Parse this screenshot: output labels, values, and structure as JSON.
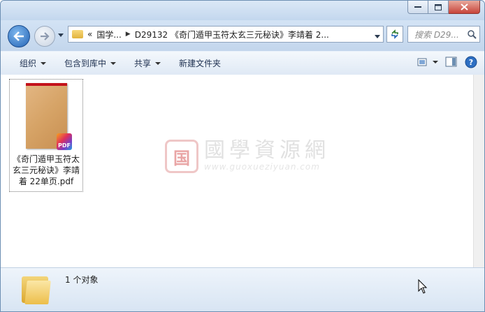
{
  "address": {
    "overflow": "«",
    "crumbs": [
      "国学...",
      "D29132 《奇门遁甲玉符太玄三元秘诀》李靖着 2..."
    ]
  },
  "search": {
    "placeholder": "搜索 D29..."
  },
  "toolbar": {
    "organize": "组织",
    "include_in_library": "包含到库中",
    "share": "共享",
    "new_folder": "新建文件夹"
  },
  "file": {
    "name": "《奇门遁甲玉符太玄三元秘诀》李靖着 22单页.pdf",
    "badge": "PDF"
  },
  "watermark": {
    "seal": "国",
    "title": "國學資源網",
    "url": "www.guoxueziyuan.com"
  },
  "status": {
    "count": "1 个对象"
  },
  "colors": {
    "accent": "#2363b5",
    "pdf_red": "#c3121b",
    "close": "#c7443a"
  }
}
